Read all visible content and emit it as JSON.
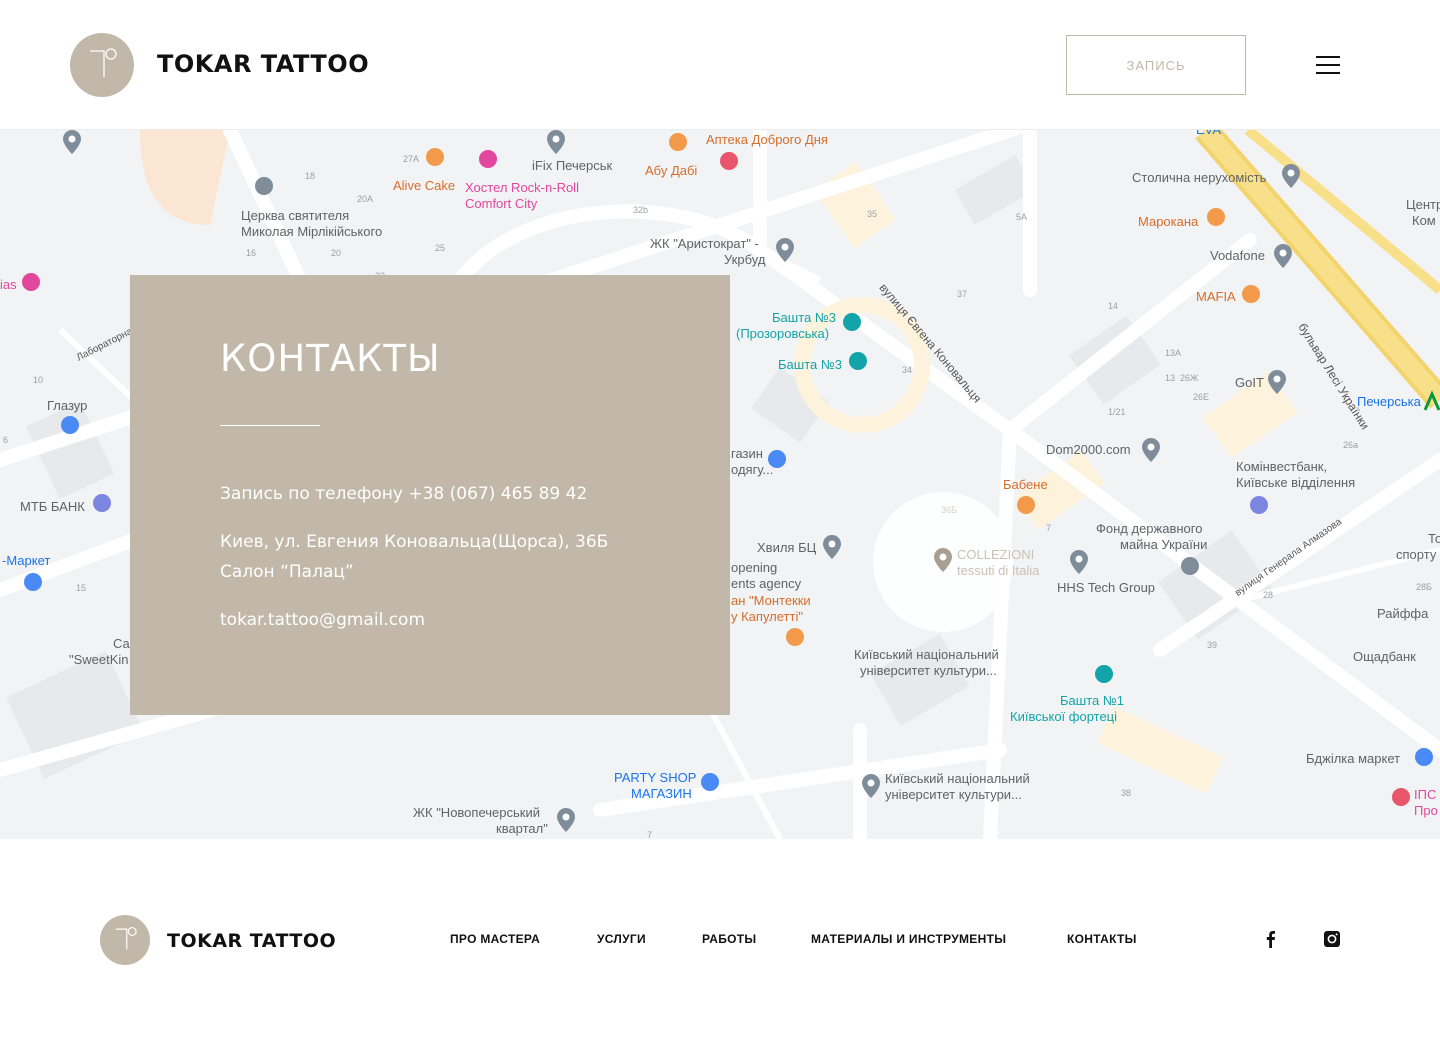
{
  "header": {
    "brand": "TOKAR TATTOO",
    "cta_label": "ЗАПИСЬ"
  },
  "map": {
    "labels": [
      "Аптека Доброго Дня",
      "Абу Дабі",
      "iFix Печерськ",
      "Alive Cake",
      "Хостел Rock-n-Roll",
      "Comfort City",
      "Церква святителя",
      "Миколая Мірлікійського",
      "ЖК \"Аристократ\" -",
      "Укрбуд",
      "Столична нерухомість",
      "Марокана",
      "Vodafone",
      "MAFIA",
      "Центральн",
      "Ком",
      "бульвар Лесі Українки",
      "Печерська",
      "вулиця Євгена Коновальця",
      "Башта №3",
      "(Прозоровська)",
      "Башта №3",
      "GoIT",
      "Dom2000.com",
      "Комінвестбанк,",
      "Київське відділення",
      "Бабене",
      "Фонд державного",
      "майна України",
      "Хвиля БЦ",
      "COLLEZIONI",
      "tessuti di Italia",
      "HHS Tech Group",
      "Райффа",
      "Ощадбанк",
      "Київський національний",
      "університет культури...",
      "Башта №1",
      "Київської фортеці",
      "Бджілка маркет",
      "PARTY SHOP",
      "МАГАЗИН",
      "Київський національний",
      "університет культури...",
      "ЖК \"Новопечерський",
      "квартал\"",
      "Глазур",
      "МТБ БАНК",
      "-Маркет",
      "Лабораторна",
      "вулиця Генерала Алмазова",
      "газин",
      "одягу...",
      "opening",
      "ents agency",
      "ан \"Монтекки",
      "у Капулетті\"",
      "Са",
      "\"SweetKin",
      "ias",
      "EVA",
      "IПС",
      "Про",
      "То",
      "спорту"
    ],
    "numbers": [
      "27А",
      "18",
      "20А",
      "16",
      "20",
      "25",
      "23",
      "32b",
      "35",
      "5А",
      "37",
      "34",
      "14",
      "13А",
      "13",
      "26Ж",
      "26Е",
      "1/21",
      "26а",
      "7",
      "36Б",
      "28",
      "28Б",
      "39",
      "38",
      "10",
      "6",
      "15",
      "7"
    ]
  },
  "contacts": {
    "title": "КОНТАКТЫ",
    "phone_line": "Запись по телефону +38 (067) 465 89 42",
    "address_line1": "Киев, ул. Евгения Коновальца(Щорса), 36Б",
    "address_line2": "Салон “Палац”",
    "email": "tokar.tattoo@gmail.com"
  },
  "footer": {
    "brand": "TOKAR TATTOO",
    "nav": [
      "ПРО МАСТЕРА",
      "УСЛУГИ",
      "РАБОТЫ",
      "МАТЕРИАЛЫ И ИНСТРУМЕНТЫ",
      "КОНТАКТЫ"
    ],
    "social": [
      "facebook-icon",
      "instagram-icon"
    ]
  },
  "colors": {
    "accent": "#c2b8a9",
    "map_bg": "#f2f3f5",
    "road": "#ffffff",
    "main_road": "#f8e08a"
  }
}
